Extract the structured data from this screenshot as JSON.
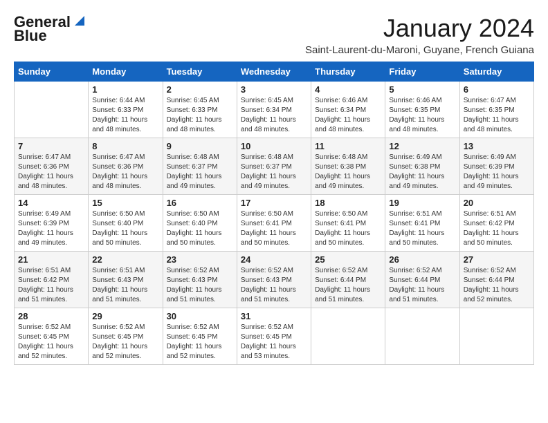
{
  "header": {
    "logo_line1": "General",
    "logo_line2": "Blue",
    "title": "January 2024",
    "subtitle": "Saint-Laurent-du-Maroni, Guyane, French Guiana"
  },
  "days_of_week": [
    "Sunday",
    "Monday",
    "Tuesday",
    "Wednesday",
    "Thursday",
    "Friday",
    "Saturday"
  ],
  "weeks": [
    [
      {
        "day": "",
        "info": ""
      },
      {
        "day": "1",
        "info": "Sunrise: 6:44 AM\nSunset: 6:33 PM\nDaylight: 11 hours\nand 48 minutes."
      },
      {
        "day": "2",
        "info": "Sunrise: 6:45 AM\nSunset: 6:33 PM\nDaylight: 11 hours\nand 48 minutes."
      },
      {
        "day": "3",
        "info": "Sunrise: 6:45 AM\nSunset: 6:34 PM\nDaylight: 11 hours\nand 48 minutes."
      },
      {
        "day": "4",
        "info": "Sunrise: 6:46 AM\nSunset: 6:34 PM\nDaylight: 11 hours\nand 48 minutes."
      },
      {
        "day": "5",
        "info": "Sunrise: 6:46 AM\nSunset: 6:35 PM\nDaylight: 11 hours\nand 48 minutes."
      },
      {
        "day": "6",
        "info": "Sunrise: 6:47 AM\nSunset: 6:35 PM\nDaylight: 11 hours\nand 48 minutes."
      }
    ],
    [
      {
        "day": "7",
        "info": "Sunrise: 6:47 AM\nSunset: 6:36 PM\nDaylight: 11 hours\nand 48 minutes."
      },
      {
        "day": "8",
        "info": "Sunrise: 6:47 AM\nSunset: 6:36 PM\nDaylight: 11 hours\nand 48 minutes."
      },
      {
        "day": "9",
        "info": "Sunrise: 6:48 AM\nSunset: 6:37 PM\nDaylight: 11 hours\nand 49 minutes."
      },
      {
        "day": "10",
        "info": "Sunrise: 6:48 AM\nSunset: 6:37 PM\nDaylight: 11 hours\nand 49 minutes."
      },
      {
        "day": "11",
        "info": "Sunrise: 6:48 AM\nSunset: 6:38 PM\nDaylight: 11 hours\nand 49 minutes."
      },
      {
        "day": "12",
        "info": "Sunrise: 6:49 AM\nSunset: 6:38 PM\nDaylight: 11 hours\nand 49 minutes."
      },
      {
        "day": "13",
        "info": "Sunrise: 6:49 AM\nSunset: 6:39 PM\nDaylight: 11 hours\nand 49 minutes."
      }
    ],
    [
      {
        "day": "14",
        "info": "Sunrise: 6:49 AM\nSunset: 6:39 PM\nDaylight: 11 hours\nand 49 minutes."
      },
      {
        "day": "15",
        "info": "Sunrise: 6:50 AM\nSunset: 6:40 PM\nDaylight: 11 hours\nand 50 minutes."
      },
      {
        "day": "16",
        "info": "Sunrise: 6:50 AM\nSunset: 6:40 PM\nDaylight: 11 hours\nand 50 minutes."
      },
      {
        "day": "17",
        "info": "Sunrise: 6:50 AM\nSunset: 6:41 PM\nDaylight: 11 hours\nand 50 minutes."
      },
      {
        "day": "18",
        "info": "Sunrise: 6:50 AM\nSunset: 6:41 PM\nDaylight: 11 hours\nand 50 minutes."
      },
      {
        "day": "19",
        "info": "Sunrise: 6:51 AM\nSunset: 6:41 PM\nDaylight: 11 hours\nand 50 minutes."
      },
      {
        "day": "20",
        "info": "Sunrise: 6:51 AM\nSunset: 6:42 PM\nDaylight: 11 hours\nand 50 minutes."
      }
    ],
    [
      {
        "day": "21",
        "info": "Sunrise: 6:51 AM\nSunset: 6:42 PM\nDaylight: 11 hours\nand 51 minutes."
      },
      {
        "day": "22",
        "info": "Sunrise: 6:51 AM\nSunset: 6:43 PM\nDaylight: 11 hours\nand 51 minutes."
      },
      {
        "day": "23",
        "info": "Sunrise: 6:52 AM\nSunset: 6:43 PM\nDaylight: 11 hours\nand 51 minutes."
      },
      {
        "day": "24",
        "info": "Sunrise: 6:52 AM\nSunset: 6:43 PM\nDaylight: 11 hours\nand 51 minutes."
      },
      {
        "day": "25",
        "info": "Sunrise: 6:52 AM\nSunset: 6:44 PM\nDaylight: 11 hours\nand 51 minutes."
      },
      {
        "day": "26",
        "info": "Sunrise: 6:52 AM\nSunset: 6:44 PM\nDaylight: 11 hours\nand 51 minutes."
      },
      {
        "day": "27",
        "info": "Sunrise: 6:52 AM\nSunset: 6:44 PM\nDaylight: 11 hours\nand 52 minutes."
      }
    ],
    [
      {
        "day": "28",
        "info": "Sunrise: 6:52 AM\nSunset: 6:45 PM\nDaylight: 11 hours\nand 52 minutes."
      },
      {
        "day": "29",
        "info": "Sunrise: 6:52 AM\nSunset: 6:45 PM\nDaylight: 11 hours\nand 52 minutes."
      },
      {
        "day": "30",
        "info": "Sunrise: 6:52 AM\nSunset: 6:45 PM\nDaylight: 11 hours\nand 52 minutes."
      },
      {
        "day": "31",
        "info": "Sunrise: 6:52 AM\nSunset: 6:45 PM\nDaylight: 11 hours\nand 53 minutes."
      },
      {
        "day": "",
        "info": ""
      },
      {
        "day": "",
        "info": ""
      },
      {
        "day": "",
        "info": ""
      }
    ]
  ]
}
